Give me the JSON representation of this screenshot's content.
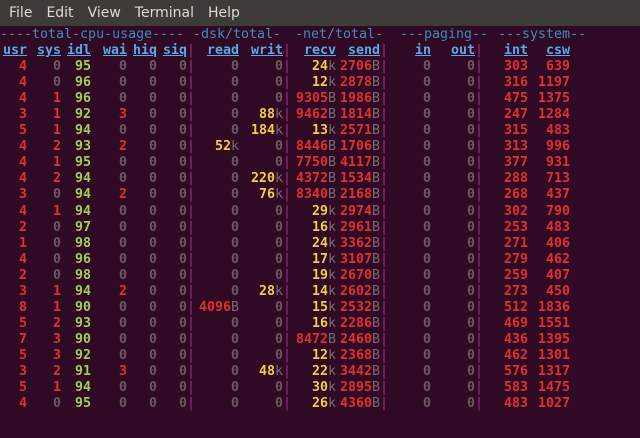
{
  "menu": [
    "File",
    "Edit",
    "View",
    "Terminal",
    "Help"
  ],
  "groups": [
    "----total-cpu-usage----",
    "-dsk/total-",
    "-net/total-",
    "---paging--",
    "---system--"
  ],
  "headers": [
    "usr",
    "sys",
    "idl",
    "wai",
    "hiq",
    "siq",
    "read",
    "writ",
    "recv",
    "send",
    "in",
    "out",
    "int",
    "csw"
  ],
  "colors": {
    "bg": "#300a24",
    "zero": "#6b5a62",
    "cpu_usr": "#e03030",
    "cpu_idl": "#a0d050",
    "kilo": "#f0d040",
    "bytes": "#e03030",
    "system": "#e03030",
    "unit": "#7a6a72",
    "sep": "#a52a8a",
    "header": "#5aa9e6"
  },
  "rows": [
    [
      "4",
      "0",
      "95",
      "0",
      "0",
      "0",
      "0",
      "0",
      "24k",
      "2706B",
      "0",
      "0",
      "303",
      "639"
    ],
    [
      "4",
      "0",
      "96",
      "0",
      "0",
      "0",
      "0",
      "0",
      "12k",
      "2878B",
      "0",
      "0",
      "316",
      "1197"
    ],
    [
      "4",
      "1",
      "96",
      "0",
      "0",
      "0",
      "0",
      "0",
      "9305B",
      "1986B",
      "0",
      "0",
      "475",
      "1375"
    ],
    [
      "3",
      "1",
      "92",
      "3",
      "0",
      "0",
      "0",
      "88k",
      "9462B",
      "1814B",
      "0",
      "0",
      "247",
      "1284"
    ],
    [
      "5",
      "1",
      "94",
      "0",
      "0",
      "0",
      "0",
      "184k",
      "13k",
      "2571B",
      "0",
      "0",
      "315",
      "483"
    ],
    [
      "4",
      "2",
      "93",
      "2",
      "0",
      "0",
      "52k",
      "0",
      "8446B",
      "1706B",
      "0",
      "0",
      "313",
      "996"
    ],
    [
      "4",
      "1",
      "95",
      "0",
      "0",
      "0",
      "0",
      "0",
      "7750B",
      "4117B",
      "0",
      "0",
      "377",
      "931"
    ],
    [
      "4",
      "2",
      "94",
      "0",
      "0",
      "0",
      "0",
      "220k",
      "4372B",
      "1534B",
      "0",
      "0",
      "288",
      "713"
    ],
    [
      "3",
      "0",
      "94",
      "2",
      "0",
      "0",
      "0",
      "76k",
      "8340B",
      "2168B",
      "0",
      "0",
      "268",
      "437"
    ],
    [
      "4",
      "1",
      "94",
      "0",
      "0",
      "0",
      "0",
      "0",
      "29k",
      "2974B",
      "0",
      "0",
      "302",
      "790"
    ],
    [
      "2",
      "0",
      "97",
      "0",
      "0",
      "0",
      "0",
      "0",
      "16k",
      "2961B",
      "0",
      "0",
      "253",
      "483"
    ],
    [
      "1",
      "0",
      "98",
      "0",
      "0",
      "0",
      "0",
      "0",
      "24k",
      "3362B",
      "0",
      "0",
      "271",
      "406"
    ],
    [
      "4",
      "0",
      "96",
      "0",
      "0",
      "0",
      "0",
      "0",
      "17k",
      "3107B",
      "0",
      "0",
      "279",
      "462"
    ],
    [
      "2",
      "0",
      "98",
      "0",
      "0",
      "0",
      "0",
      "0",
      "19k",
      "2670B",
      "0",
      "0",
      "259",
      "407"
    ],
    [
      "3",
      "1",
      "94",
      "2",
      "0",
      "0",
      "0",
      "28k",
      "14k",
      "2602B",
      "0",
      "0",
      "273",
      "450"
    ],
    [
      "8",
      "1",
      "90",
      "0",
      "0",
      "0",
      "4096B",
      "0",
      "15k",
      "2532B",
      "0",
      "0",
      "512",
      "1836"
    ],
    [
      "5",
      "2",
      "93",
      "0",
      "0",
      "0",
      "0",
      "0",
      "16k",
      "2286B",
      "0",
      "0",
      "469",
      "1551"
    ],
    [
      "7",
      "3",
      "90",
      "0",
      "0",
      "0",
      "0",
      "0",
      "8472B",
      "2460B",
      "0",
      "0",
      "436",
      "1395"
    ],
    [
      "5",
      "3",
      "92",
      "0",
      "0",
      "0",
      "0",
      "0",
      "12k",
      "2368B",
      "0",
      "0",
      "462",
      "1301"
    ],
    [
      "3",
      "2",
      "91",
      "3",
      "0",
      "0",
      "0",
      "48k",
      "22k",
      "3442B",
      "0",
      "0",
      "576",
      "1317"
    ],
    [
      "5",
      "1",
      "94",
      "0",
      "0",
      "0",
      "0",
      "0",
      "30k",
      "2895B",
      "0",
      "0",
      "583",
      "1475"
    ],
    [
      "4",
      "0",
      "95",
      "0",
      "0",
      "0",
      "0",
      "0",
      "26k",
      "4360B",
      "0",
      "0",
      "483",
      "1027"
    ]
  ]
}
